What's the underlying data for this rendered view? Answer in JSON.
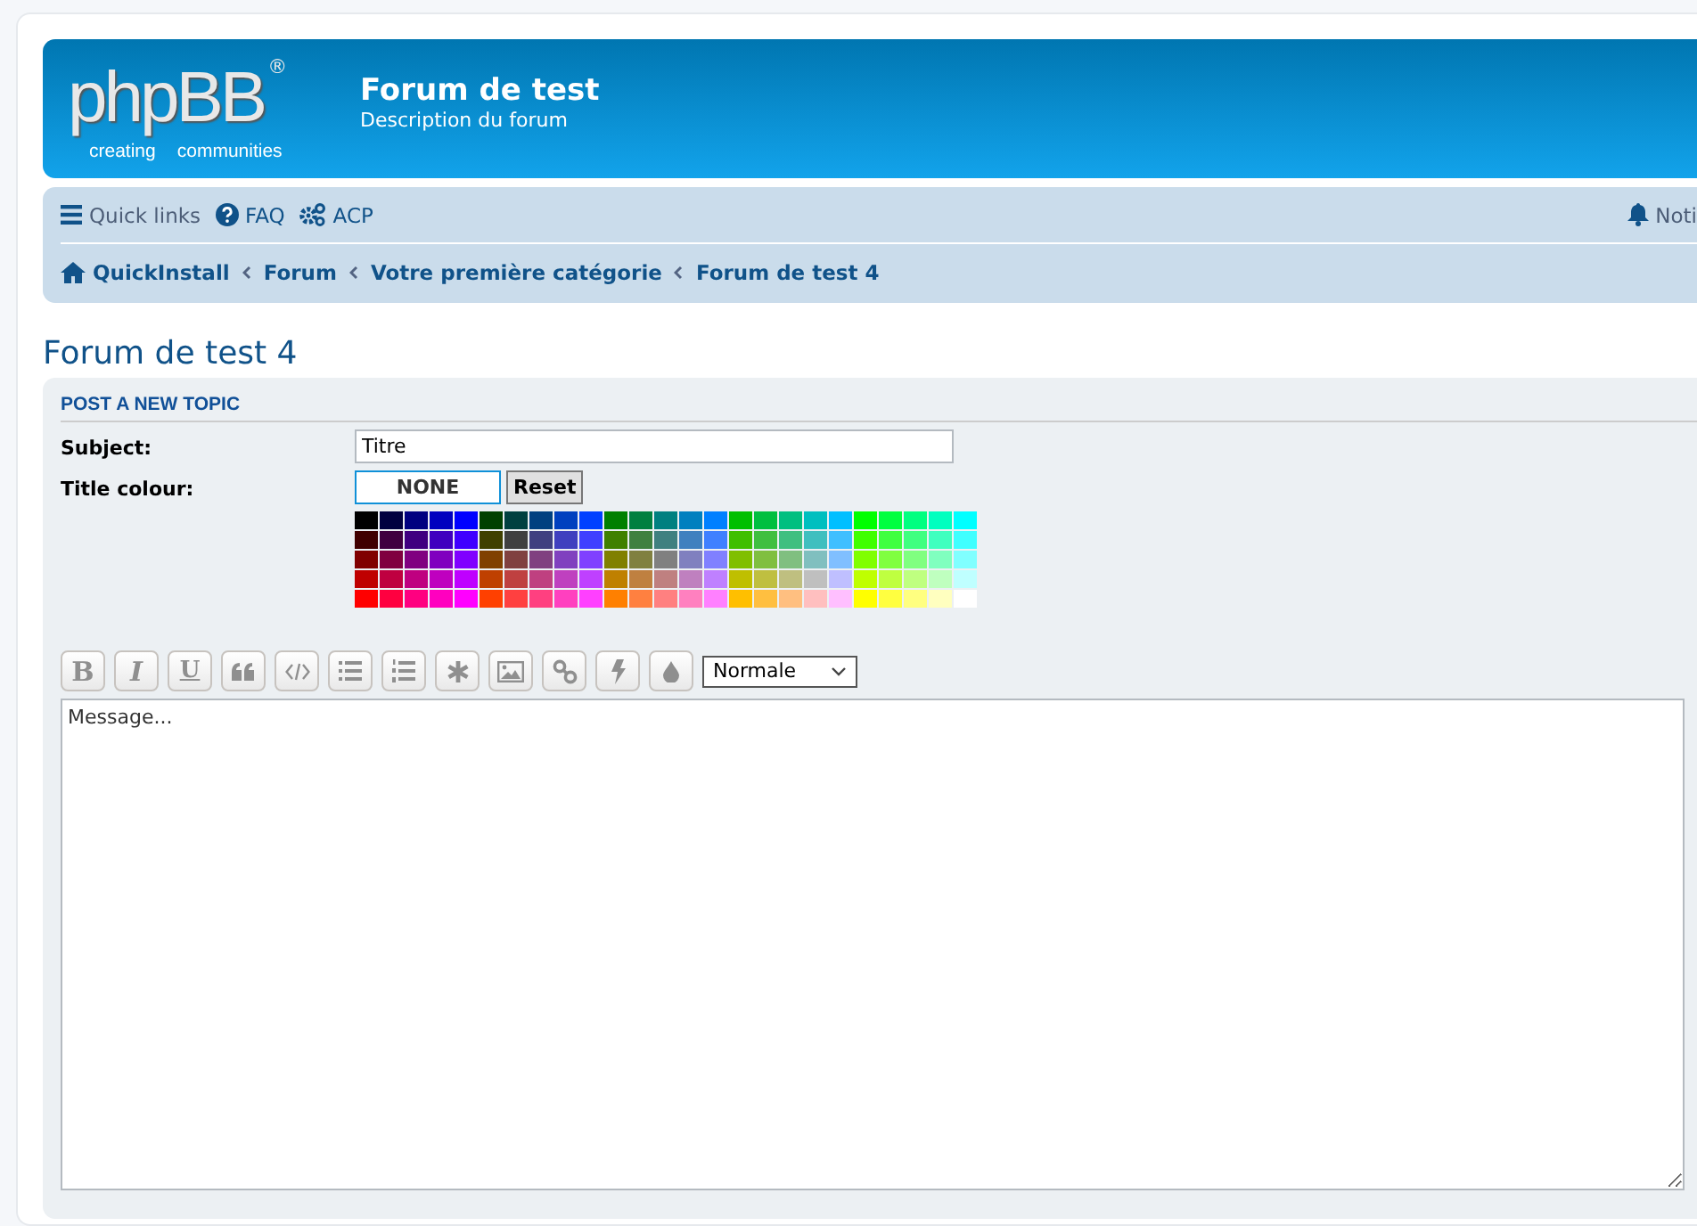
{
  "header": {
    "logo_text": "phpBB",
    "logo_mark": "®",
    "logo_tagline": [
      "creating",
      "communities"
    ],
    "site_title": "Forum de test",
    "site_description": "Description du forum"
  },
  "navbar": {
    "links": [
      {
        "kind": "menu",
        "label": "Quick links"
      },
      {
        "kind": "help",
        "label": "FAQ"
      },
      {
        "kind": "gears",
        "label": "ACP"
      }
    ],
    "notifications": "Noti",
    "breadcrumbs": [
      {
        "kind": "home",
        "label": "QuickInstall"
      },
      {
        "kind": "crumb",
        "label": "Forum"
      },
      {
        "kind": "crumb",
        "label": "Votre première catégorie"
      },
      {
        "kind": "crumb",
        "label": "Forum de test 4"
      }
    ]
  },
  "page_title": "Forum de test 4",
  "panel": {
    "heading": "POST A NEW TOPIC",
    "subject_label": "Subject:",
    "subject_value": "Titre",
    "colour_label": "Title colour:",
    "colour_value": "NONE",
    "reset_button": "Reset",
    "palette": [
      {
        "swatches": [
          {
            "color": "#000000"
          },
          {
            "color": "#000040"
          },
          {
            "color": "#000080"
          },
          {
            "color": "#0000bf"
          },
          {
            "color": "#0000ff"
          },
          {
            "color": "#004000"
          },
          {
            "color": "#004040"
          },
          {
            "color": "#004080"
          },
          {
            "color": "#0040bf"
          },
          {
            "color": "#0040ff"
          },
          {
            "color": "#008000"
          },
          {
            "color": "#008040"
          },
          {
            "color": "#008080"
          },
          {
            "color": "#0080bf"
          },
          {
            "color": "#0080ff"
          },
          {
            "color": "#00bf00"
          },
          {
            "color": "#00bf40"
          },
          {
            "color": "#00bf80"
          },
          {
            "color": "#00bfbf"
          },
          {
            "color": "#00bfff"
          },
          {
            "color": "#00ff00"
          },
          {
            "color": "#00ff40"
          },
          {
            "color": "#00ff80"
          },
          {
            "color": "#00ffbf"
          },
          {
            "color": "#00ffff"
          }
        ]
      },
      {
        "swatches": [
          {
            "color": "#400000"
          },
          {
            "color": "#400040"
          },
          {
            "color": "#400080"
          },
          {
            "color": "#4000bf"
          },
          {
            "color": "#4000ff"
          },
          {
            "color": "#404000"
          },
          {
            "color": "#404040"
          },
          {
            "color": "#404080"
          },
          {
            "color": "#4040bf"
          },
          {
            "color": "#4040ff"
          },
          {
            "color": "#408000"
          },
          {
            "color": "#408040"
          },
          {
            "color": "#408080"
          },
          {
            "color": "#4080bf"
          },
          {
            "color": "#4080ff"
          },
          {
            "color": "#40bf00"
          },
          {
            "color": "#40bf40"
          },
          {
            "color": "#40bf80"
          },
          {
            "color": "#40bfbf"
          },
          {
            "color": "#40bfff"
          },
          {
            "color": "#40ff00"
          },
          {
            "color": "#40ff40"
          },
          {
            "color": "#40ff80"
          },
          {
            "color": "#40ffbf"
          },
          {
            "color": "#40ffff"
          }
        ]
      },
      {
        "swatches": [
          {
            "color": "#800000"
          },
          {
            "color": "#800040"
          },
          {
            "color": "#800080"
          },
          {
            "color": "#8000bf"
          },
          {
            "color": "#8000ff"
          },
          {
            "color": "#804000"
          },
          {
            "color": "#804040"
          },
          {
            "color": "#804080"
          },
          {
            "color": "#8040bf"
          },
          {
            "color": "#8040ff"
          },
          {
            "color": "#808000"
          },
          {
            "color": "#808040"
          },
          {
            "color": "#808080"
          },
          {
            "color": "#8080bf"
          },
          {
            "color": "#8080ff"
          },
          {
            "color": "#80bf00"
          },
          {
            "color": "#80bf40"
          },
          {
            "color": "#80bf80"
          },
          {
            "color": "#80bfbf"
          },
          {
            "color": "#80bfff"
          },
          {
            "color": "#80ff00"
          },
          {
            "color": "#80ff40"
          },
          {
            "color": "#80ff80"
          },
          {
            "color": "#80ffbf"
          },
          {
            "color": "#80ffff"
          }
        ]
      },
      {
        "swatches": [
          {
            "color": "#bf0000"
          },
          {
            "color": "#bf0040"
          },
          {
            "color": "#bf0080"
          },
          {
            "color": "#bf00bf"
          },
          {
            "color": "#bf00ff"
          },
          {
            "color": "#bf4000"
          },
          {
            "color": "#bf4040"
          },
          {
            "color": "#bf4080"
          },
          {
            "color": "#bf40bf"
          },
          {
            "color": "#bf40ff"
          },
          {
            "color": "#bf8000"
          },
          {
            "color": "#bf8040"
          },
          {
            "color": "#bf8080"
          },
          {
            "color": "#bf80bf"
          },
          {
            "color": "#bf80ff"
          },
          {
            "color": "#bfbf00"
          },
          {
            "color": "#bfbf40"
          },
          {
            "color": "#bfbf80"
          },
          {
            "color": "#bfbfbf"
          },
          {
            "color": "#bfbfff"
          },
          {
            "color": "#bfff00"
          },
          {
            "color": "#bfff40"
          },
          {
            "color": "#bfff80"
          },
          {
            "color": "#bfffbf"
          },
          {
            "color": "#bfffff"
          }
        ]
      },
      {
        "swatches": [
          {
            "color": "#ff0000"
          },
          {
            "color": "#ff0040"
          },
          {
            "color": "#ff0080"
          },
          {
            "color": "#ff00bf"
          },
          {
            "color": "#ff00ff"
          },
          {
            "color": "#ff4000"
          },
          {
            "color": "#ff4040"
          },
          {
            "color": "#ff4080"
          },
          {
            "color": "#ff40bf"
          },
          {
            "color": "#ff40ff"
          },
          {
            "color": "#ff8000"
          },
          {
            "color": "#ff8040"
          },
          {
            "color": "#ff8080"
          },
          {
            "color": "#ff80bf"
          },
          {
            "color": "#ff80ff"
          },
          {
            "color": "#ffbf00"
          },
          {
            "color": "#ffbf40"
          },
          {
            "color": "#ffbf80"
          },
          {
            "color": "#ffbfbf"
          },
          {
            "color": "#ffbfff"
          },
          {
            "color": "#ffff00"
          },
          {
            "color": "#ffff40"
          },
          {
            "color": "#ffff80"
          },
          {
            "color": "#ffffbf"
          },
          {
            "color": "#ffffff"
          }
        ]
      }
    ],
    "toolbar": [
      {
        "kind": "bold",
        "label": "B"
      },
      {
        "kind": "italic",
        "label": "I"
      },
      {
        "kind": "underline",
        "label": "U"
      },
      {
        "kind": "quote"
      },
      {
        "kind": "code"
      },
      {
        "kind": "list"
      },
      {
        "kind": "numbered-list"
      },
      {
        "kind": "asterisk"
      },
      {
        "kind": "image"
      },
      {
        "kind": "link"
      },
      {
        "kind": "flash"
      },
      {
        "kind": "drop"
      }
    ],
    "font_size": "Normale",
    "message_placeholder": "Message..."
  }
}
